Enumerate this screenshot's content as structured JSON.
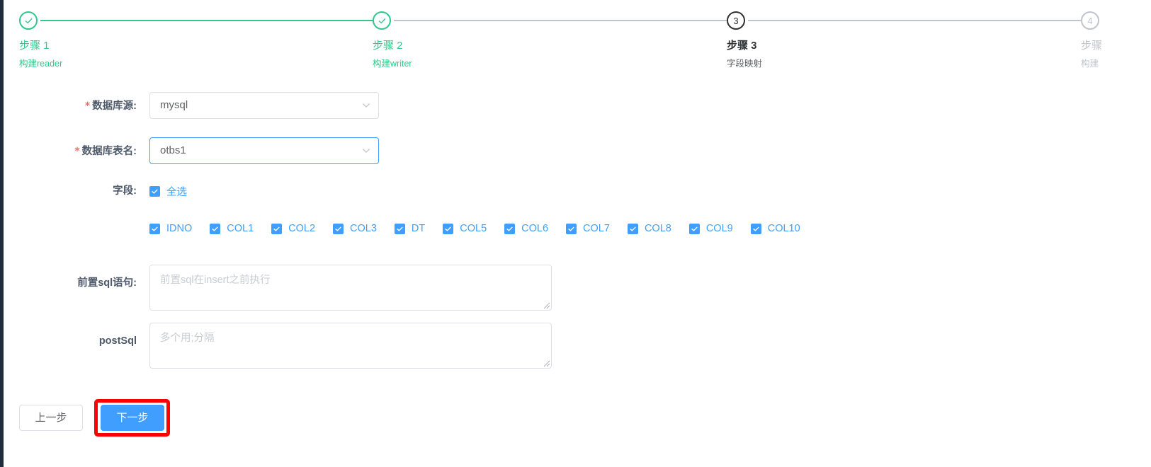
{
  "colors": {
    "done": "#2ec98c",
    "active": "#303133",
    "pending": "#c0c4cc",
    "accent": "#409eff",
    "required": "#f56c6c",
    "highlight": "#ff0000",
    "rail": "#1f2d3d"
  },
  "steps": [
    {
      "num": "1",
      "title": "步骤 1",
      "desc": "构建reader",
      "state": "done"
    },
    {
      "num": "2",
      "title": "步骤 2",
      "desc": "构建writer",
      "state": "done"
    },
    {
      "num": "3",
      "title": "步骤 3",
      "desc": "字段映射",
      "state": "active"
    },
    {
      "num": "4",
      "title": "步骤",
      "desc": "构建",
      "state": "pending"
    }
  ],
  "form": {
    "datasource": {
      "label": "数据库源:",
      "required": true,
      "value": "mysql"
    },
    "table": {
      "label": "数据库表名:",
      "required": true,
      "value": "otbs1",
      "focused": true
    },
    "fields": {
      "label": "字段:",
      "select_all_label": "全选",
      "select_all_checked": true,
      "columns": [
        {
          "label": "IDNO",
          "checked": true
        },
        {
          "label": "COL1",
          "checked": true
        },
        {
          "label": "COL2",
          "checked": true
        },
        {
          "label": "COL3",
          "checked": true
        },
        {
          "label": "DT",
          "checked": true
        },
        {
          "label": "COL5",
          "checked": true
        },
        {
          "label": "COL6",
          "checked": true
        },
        {
          "label": "COL7",
          "checked": true
        },
        {
          "label": "COL8",
          "checked": true
        },
        {
          "label": "COL9",
          "checked": true
        },
        {
          "label": "COL10",
          "checked": true
        }
      ]
    },
    "presql": {
      "label": "前置sql语句:",
      "placeholder": "前置sql在insert之前执行",
      "value": ""
    },
    "postsql": {
      "label": "postSql",
      "placeholder": "多个用;分隔",
      "value": ""
    }
  },
  "footer": {
    "prev_label": "上一步",
    "next_label": "下一步"
  }
}
